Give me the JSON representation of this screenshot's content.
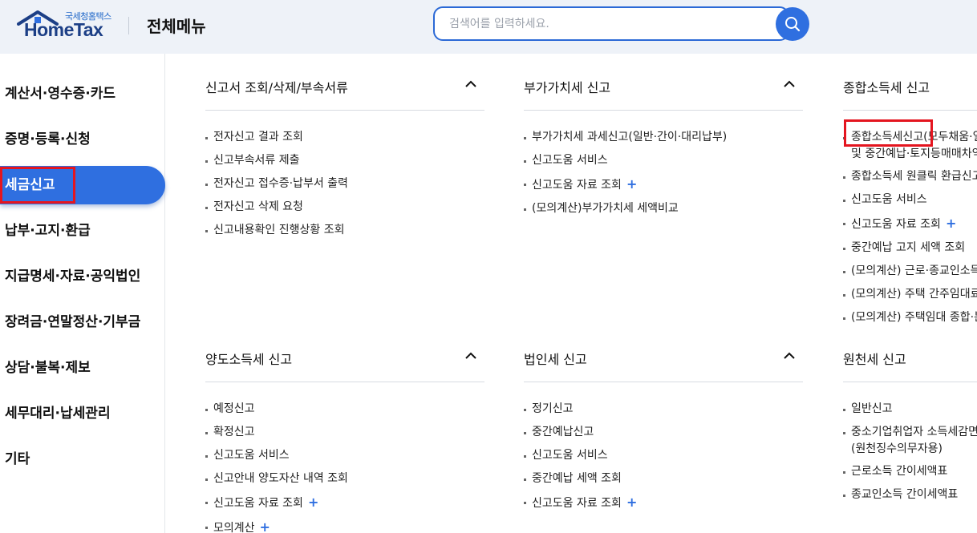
{
  "header": {
    "logo_sub": "국세청홈택스",
    "logo_main": "HomeTax",
    "title": "전체메뉴",
    "search_placeholder": "검색어를 입력하세요."
  },
  "sidebar": {
    "items": [
      {
        "label": "계산서·영수증·카드"
      },
      {
        "label": "증명·등록·신청"
      },
      {
        "label": "세금신고",
        "active": true
      },
      {
        "label": "납부·고지·환급"
      },
      {
        "label": "지급명세·자료·공익법인"
      },
      {
        "label": "장려금·연말정산·기부금"
      },
      {
        "label": "상담·불복·제보"
      },
      {
        "label": "세무대리·납세관리"
      },
      {
        "label": "기타"
      }
    ]
  },
  "sections": [
    {
      "title": "신고서 조회/삭제/부속서류",
      "items": [
        {
          "label": "전자신고 결과 조회"
        },
        {
          "label": "신고부속서류 제출"
        },
        {
          "label": "전자신고 접수증·납부서 출력"
        },
        {
          "label": "전자신고 삭제 요청"
        },
        {
          "label": "신고내용확인 진행상황 조회"
        }
      ]
    },
    {
      "title": "부가가치세 신고",
      "items": [
        {
          "label": "부가가치세 과세신고(일반·간이·대리납부)"
        },
        {
          "label": "신고도움 서비스"
        },
        {
          "label": "신고도움 자료 조회",
          "plus": "+"
        },
        {
          "label": "(모의계산)부가가치세 세액비교"
        }
      ]
    },
    {
      "title": "종합소득세 신고",
      "items": [
        {
          "label": "종합소득세신고(모두채움·일",
          "label2": "및 중간예납·토지등매매차익"
        },
        {
          "label": "종합소득세 원클릭 환급신고"
        },
        {
          "label": "신고도움 서비스"
        },
        {
          "label": "신고도움 자료 조회",
          "plus": "+"
        },
        {
          "label": "중간예납 고지 세액 조회"
        },
        {
          "label": "(모의계산) 근로·종교인소득"
        },
        {
          "label": "(모의계산) 주택 간주임대료"
        },
        {
          "label": "(모의계산) 주택임대 종합·분"
        }
      ]
    },
    {
      "title": "양도소득세 신고",
      "items": [
        {
          "label": "예정신고"
        },
        {
          "label": "확정신고"
        },
        {
          "label": "신고도움 서비스"
        },
        {
          "label": "신고안내 양도자산 내역 조회"
        },
        {
          "label": "신고도움 자료 조회",
          "plus": "+"
        },
        {
          "label": "모의계산",
          "plus": "+"
        }
      ]
    },
    {
      "title": "법인세 신고",
      "items": [
        {
          "label": "정기신고"
        },
        {
          "label": "중간예납신고"
        },
        {
          "label": "신고도움 서비스"
        },
        {
          "label": "중간예납 세액 조회"
        },
        {
          "label": "신고도움 자료 조회",
          "plus": "+"
        }
      ]
    },
    {
      "title": "원천세 신고",
      "items": [
        {
          "label": "일반신고"
        },
        {
          "label": "중소기업취업자 소득세감면",
          "label2": "(원천징수의무자용)"
        },
        {
          "label": "근로소득 간이세액표"
        },
        {
          "label": "종교인소득 간이세액표"
        }
      ]
    }
  ],
  "colors": {
    "accent": "#2f6fe0",
    "highlight": "#e4151f",
    "header_bg": "#eef2f8"
  }
}
